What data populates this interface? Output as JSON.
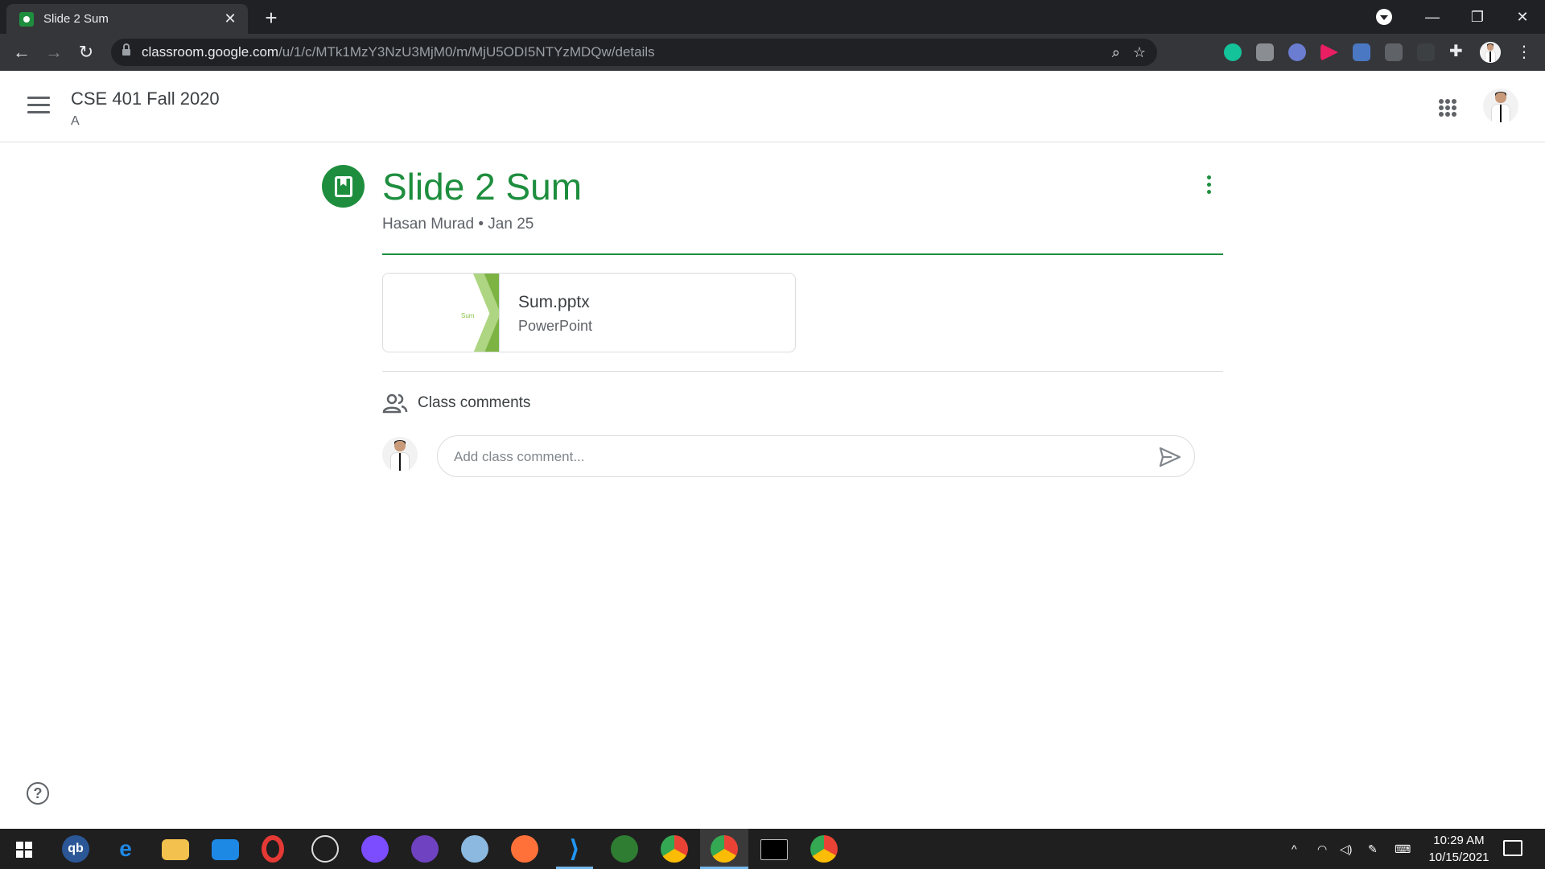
{
  "browser": {
    "tab_title": "Slide 2 Sum",
    "tab_close": "✕",
    "new_tab": "+",
    "url_host": "classroom.google.com",
    "url_path": "/u/1/c/MTk1MzY3NzU3MjM0/m/MjU5ODI5NTYzMDQw/details",
    "back": "←",
    "forward": "→",
    "reload": "↻",
    "minimize": "—",
    "restore": "❐",
    "close": "✕",
    "zoom_icon": "⌕",
    "star_icon": "☆",
    "menu": "⋮"
  },
  "classroom": {
    "class_name": "CSE 401 Fall 2020",
    "section": "A"
  },
  "post": {
    "title": "Slide 2 Sum",
    "author": "Hasan Murad",
    "separator": "•",
    "date": "Jan 25",
    "attachment": {
      "thumb_text": "Sum",
      "name": "Sum.pptx",
      "type": "PowerPoint"
    }
  },
  "comments": {
    "label": "Class comments",
    "placeholder": "Add class comment..."
  },
  "help": "?",
  "taskbar": {
    "time": "10:29 AM",
    "date": "10/15/2021",
    "apps": [
      "qb-icon",
      "edge-icon",
      "file-explorer-icon",
      "mail-icon",
      "opera-icon",
      "satellite-icon",
      "messenger-icon",
      "github-icon",
      "paint-icon",
      "firefox-icon",
      "vscode-icon",
      "earth-icon",
      "chrome-icon",
      "chrome-active-icon",
      "terminal-icon",
      "chrome-profile-icon"
    ]
  },
  "colors": {
    "accent": "#1e8e3e",
    "chrome_dark": "#202124",
    "taskbar": "#1f1f1f"
  }
}
